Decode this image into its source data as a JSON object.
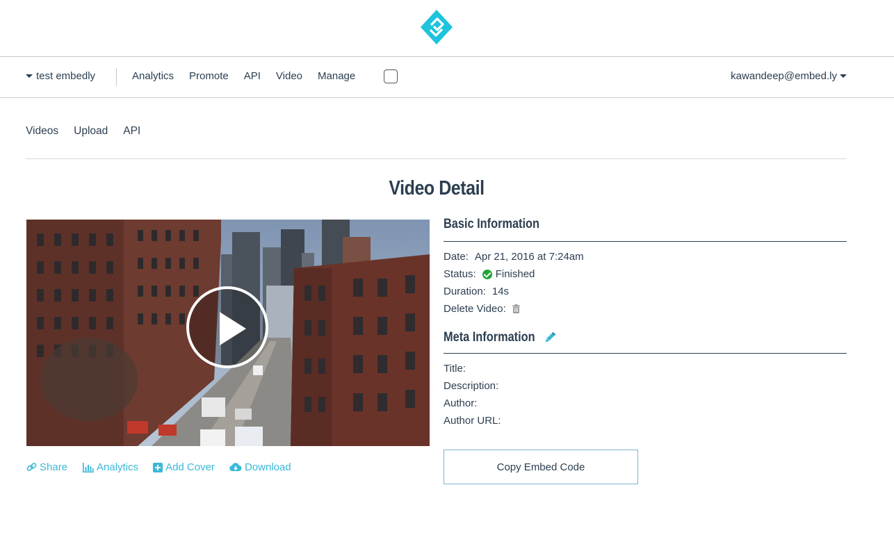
{
  "header": {
    "logo_icon": "embedly-logo-icon",
    "brand_color": "#1ec3dc"
  },
  "navbar": {
    "org_label": "test embedly",
    "links": [
      "Analytics",
      "Promote",
      "API",
      "Video",
      "Manage"
    ],
    "user_label": "kawandeep@embed.ly"
  },
  "subnav": {
    "links": [
      "Videos",
      "Upload",
      "API"
    ]
  },
  "page": {
    "title": "Video Detail"
  },
  "video": {
    "play_icon": "play-icon"
  },
  "actions": {
    "share": "Share",
    "analytics": "Analytics",
    "add_cover": "Add Cover",
    "download": "Download",
    "link_color": "#3ab8d8"
  },
  "basic_info": {
    "heading": "Basic Information",
    "date_label": "Date:",
    "date_value": "Apr 21, 2016 at 7:24am",
    "status_label": "Status:",
    "status_value": "Finished",
    "duration_label": "Duration:",
    "duration_value": "14s",
    "delete_label": "Delete Video:"
  },
  "meta_info": {
    "heading": "Meta Information",
    "title_label": "Title:",
    "description_label": "Description:",
    "author_label": "Author:",
    "author_url_label": "Author URL:"
  },
  "copy_button": "Copy Embed Code"
}
